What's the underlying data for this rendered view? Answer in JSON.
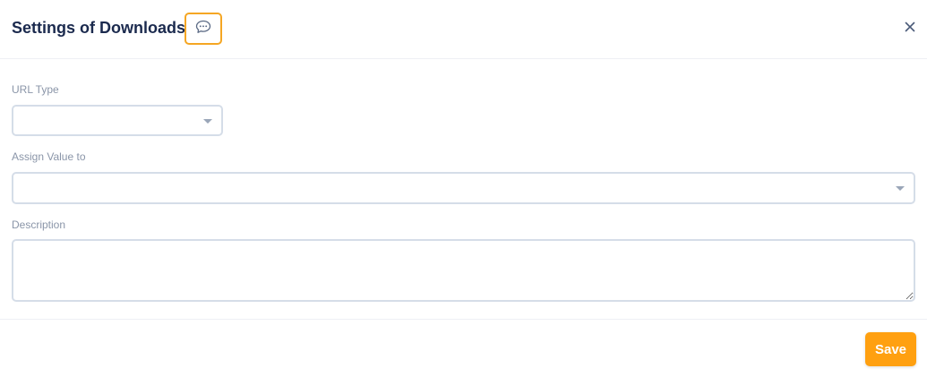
{
  "dialog": {
    "title": "Settings of Downloads",
    "comment_icon": "chat-bubble-ellipsis-icon",
    "close_icon": "close-icon"
  },
  "form": {
    "url_type": {
      "label": "URL Type",
      "value": ""
    },
    "assign_value_to": {
      "label": "Assign Value to",
      "value": ""
    },
    "description": {
      "label": "Description",
      "value": ""
    }
  },
  "footer": {
    "save_label": "Save"
  },
  "colors": {
    "accent": "#ffa010",
    "accent_border": "#f5a623",
    "title": "#1b2a4e",
    "label": "#8a95a8",
    "input_border": "#d5dde8"
  }
}
